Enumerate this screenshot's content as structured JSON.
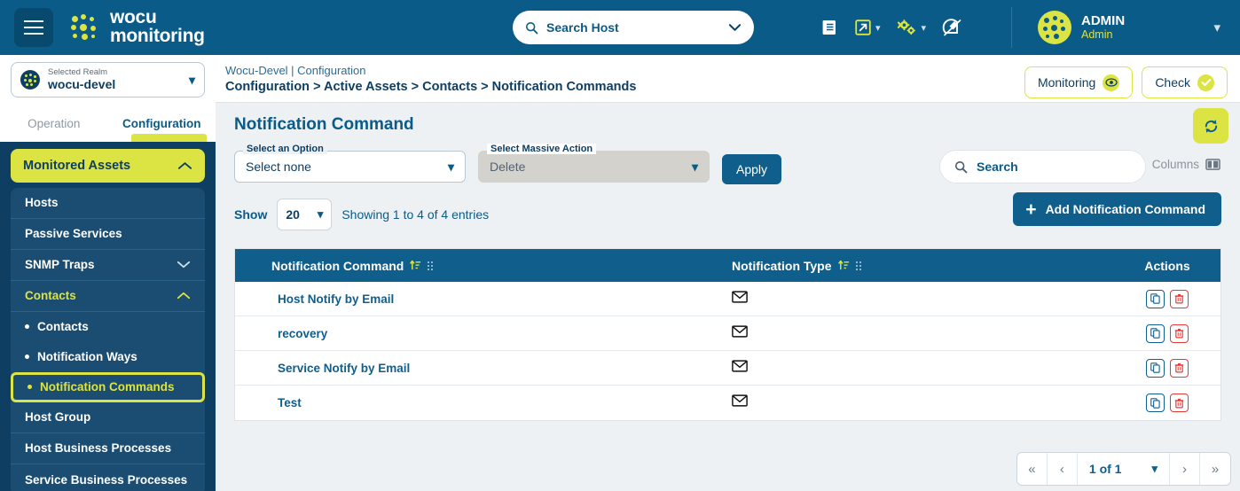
{
  "brand": {
    "line1": "wocu",
    "line2": "monitoring"
  },
  "header": {
    "search_host_placeholder": "Search Host",
    "icons": [
      "document-icon",
      "external-link-icon",
      "gear-settings-icon",
      "satellite-icon"
    ],
    "user": {
      "name": "ADMIN",
      "role": "Admin"
    }
  },
  "sidebar": {
    "realm": {
      "label": "Selected Realm",
      "value": "wocu-devel"
    },
    "tabs": [
      {
        "label": "Operation",
        "active": false
      },
      {
        "label": "Configuration",
        "active": true
      }
    ],
    "group": {
      "label": "Monitored Assets"
    },
    "items": [
      {
        "label": "Hosts",
        "type": "item"
      },
      {
        "label": "Passive Services",
        "type": "item"
      },
      {
        "label": "SNMP Traps",
        "type": "collapsible",
        "expanded": false
      },
      {
        "label": "Contacts",
        "type": "collapsible",
        "expanded": true
      },
      {
        "label": "Contacts",
        "type": "sub"
      },
      {
        "label": "Notification Ways",
        "type": "sub"
      },
      {
        "label": "Notification Commands",
        "type": "sub",
        "current": true
      },
      {
        "label": "Host Group",
        "type": "item"
      },
      {
        "label": "Host Business Processes",
        "type": "item"
      },
      {
        "label": "Service Business Processes",
        "type": "item"
      }
    ]
  },
  "breadcrumb": {
    "top": "Wocu-Devel | Configuration",
    "path": "Configuration > Active Assets > Contacts > Notification Commands",
    "buttons": [
      {
        "label": "Monitoring",
        "icon": "eye-icon"
      },
      {
        "label": "Check",
        "icon": "check-icon"
      }
    ]
  },
  "page": {
    "title": "Notification Command",
    "refresh_icon": "refresh-icon"
  },
  "toolbar": {
    "option_label": "Select an Option",
    "option_value": "Select none",
    "massive_label": "Select Massive Action",
    "massive_value": "Delete",
    "apply_label": "Apply",
    "search_placeholder": "Search",
    "columns_label": "Columns"
  },
  "showrow": {
    "show_label": "Show",
    "page_size": "20",
    "entries_text": "Showing 1 to 4 of 4 entries",
    "add_label": "Add Notification Command"
  },
  "table": {
    "columns": [
      "Notification Command",
      "Notification Type",
      "Actions"
    ],
    "rows": [
      {
        "name": "Host Notify by Email",
        "type_icon": "envelope-icon"
      },
      {
        "name": "recovery",
        "type_icon": "envelope-icon"
      },
      {
        "name": "Service Notify by Email",
        "type_icon": "envelope-icon"
      },
      {
        "name": "Test",
        "type_icon": "envelope-icon"
      }
    ],
    "row_actions": [
      {
        "name": "copy-icon"
      },
      {
        "name": "delete-icon"
      }
    ]
  },
  "pagination": {
    "value": "1 of 1"
  },
  "colors": {
    "brand_blue": "#0a5b87",
    "dark_blue": "#0e3e62",
    "accent_yellow": "#dbe442",
    "danger_red": "#e53935"
  }
}
